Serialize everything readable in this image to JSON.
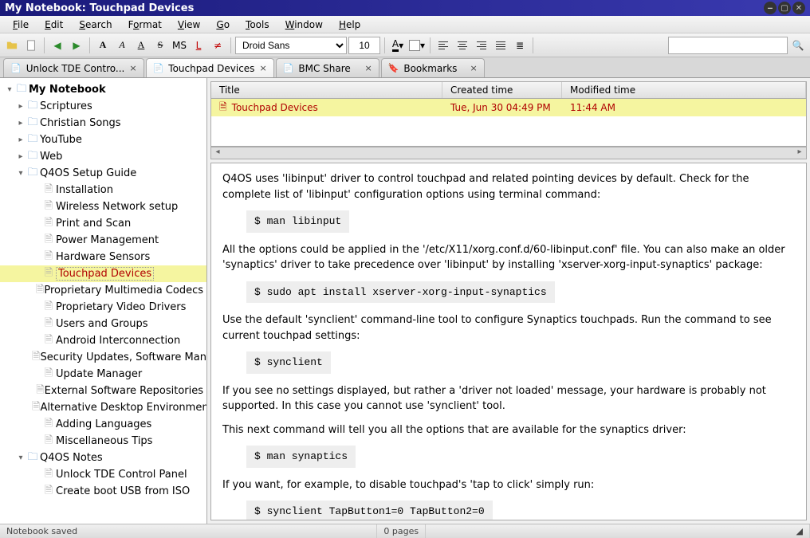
{
  "window": {
    "title": "My Notebook: Touchpad Devices"
  },
  "menu": [
    "File",
    "Edit",
    "Search",
    "Format",
    "View",
    "Go",
    "Tools",
    "Window",
    "Help"
  ],
  "toolbar": {
    "font_family": "Droid Sans",
    "font_size": "10",
    "mono_label": "MS",
    "link_label": "L"
  },
  "tabs": [
    {
      "label": "Unlock TDE Contro...",
      "icon": "page",
      "active": false
    },
    {
      "label": "Touchpad Devices",
      "icon": "page",
      "active": true
    },
    {
      "label": "BMC Share",
      "icon": "page",
      "active": false
    },
    {
      "label": "Bookmarks",
      "icon": "bookmark",
      "active": false
    }
  ],
  "tree": [
    {
      "label": "My Notebook",
      "type": "folder",
      "level": 0,
      "expanded": true,
      "root": true
    },
    {
      "label": "Scriptures",
      "type": "folder",
      "level": 1,
      "expanded": false,
      "has_children": true
    },
    {
      "label": "Christian Songs",
      "type": "folder",
      "level": 1,
      "expanded": false,
      "has_children": true
    },
    {
      "label": "YouTube",
      "type": "folder",
      "level": 1,
      "expanded": false,
      "has_children": true
    },
    {
      "label": "Web",
      "type": "folder",
      "level": 1,
      "expanded": false,
      "has_children": true
    },
    {
      "label": "Q4OS Setup Guide",
      "type": "folder",
      "level": 1,
      "expanded": true,
      "has_children": true
    },
    {
      "label": "Installation",
      "type": "page",
      "level": 2
    },
    {
      "label": "Wireless Network setup",
      "type": "page",
      "level": 2
    },
    {
      "label": "Print and Scan",
      "type": "page",
      "level": 2
    },
    {
      "label": "Power Management",
      "type": "page",
      "level": 2
    },
    {
      "label": "Hardware Sensors",
      "type": "page",
      "level": 2
    },
    {
      "label": "Touchpad Devices",
      "type": "page",
      "level": 2,
      "selected": true
    },
    {
      "label": "Proprietary Multimedia Codecs",
      "type": "page",
      "level": 2
    },
    {
      "label": "Proprietary Video Drivers",
      "type": "page",
      "level": 2
    },
    {
      "label": "Users and Groups",
      "type": "page",
      "level": 2
    },
    {
      "label": "Android Interconnection",
      "type": "page",
      "level": 2
    },
    {
      "label": "Security Updates, Software Manager",
      "type": "page",
      "level": 2
    },
    {
      "label": "Update Manager",
      "type": "page",
      "level": 2
    },
    {
      "label": "External Software Repositories",
      "type": "page",
      "level": 2
    },
    {
      "label": "Alternative Desktop Environments",
      "type": "page",
      "level": 2
    },
    {
      "label": "Adding Languages",
      "type": "page",
      "level": 2
    },
    {
      "label": "Miscellaneous Tips",
      "type": "page",
      "level": 2
    },
    {
      "label": "Q4OS Notes",
      "type": "folder",
      "level": 1,
      "expanded": true,
      "has_children": true
    },
    {
      "label": "Unlock TDE Control Panel",
      "type": "page",
      "level": 2
    },
    {
      "label": "Create boot USB from ISO",
      "type": "page",
      "level": 2
    }
  ],
  "list": {
    "columns": {
      "title": "Title",
      "created": "Created time",
      "modified": "Modified time"
    },
    "rows": [
      {
        "title": "Touchpad Devices",
        "created": "Tue, Jun 30 04:49 PM",
        "modified": "11:44 AM",
        "selected": true
      }
    ]
  },
  "note": {
    "p1": "Q4OS uses 'libinput' driver to control touchpad and related pointing devices by default. Check for the complete list of 'libinput' configuration options using terminal command:",
    "c1": "$ man libinput",
    "p2": "All the options could be applied in the '/etc/X11/xorg.conf.d/60-libinput.conf' file. You can also make an older 'synaptics' driver to take precedence over 'libinput' by installing 'xserver-xorg-input-synaptics' package:",
    "c2": "$ sudo apt install xserver-xorg-input-synaptics",
    "p3": "Use the default 'synclient' command-line tool to configure Synaptics touchpads. Run the command to see current touchpad settings:",
    "c3": "$ synclient",
    "p4": "If you see no settings displayed, but rather a 'driver not loaded' message, your hardware is probably not supported. In this case you cannot use 'synclient' tool.",
    "p5": "This next command will tell you all the options that are available for the synaptics driver:",
    "c5": "$ man synaptics",
    "p6": "If you want, for example, to disable touchpad's 'tap to click' simply run:",
    "c6": "$ synclient TapButton1=0 TapButton2=0"
  },
  "status": {
    "left": "Notebook saved",
    "pages": "0 pages"
  }
}
